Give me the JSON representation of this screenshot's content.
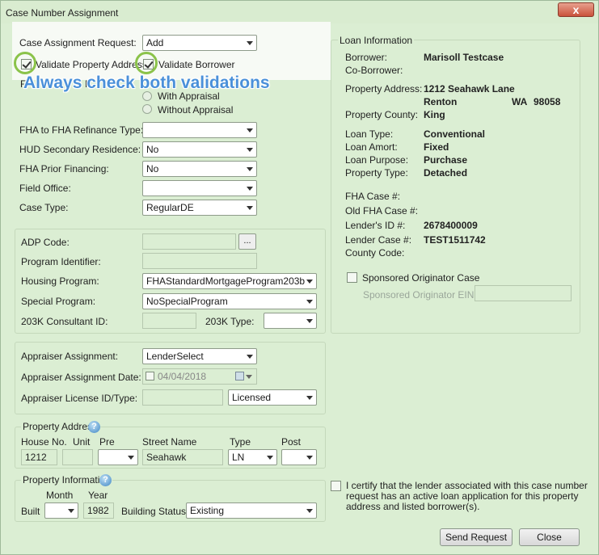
{
  "window": {
    "title": "Case Number Assignment",
    "close_glyph": "x"
  },
  "annotation": {
    "callout": "Always check both validations",
    "highlight_color": "#8bc34a",
    "callout_color": "#4a90d9"
  },
  "request": {
    "case_assignment_label": "Case Assignment Request:",
    "case_assignment_value": "Add",
    "validate_property_label": "Validate Property Address",
    "validate_property_checked": true,
    "validate_borrower_label": "Validate Borrower",
    "validate_borrower_checked": true,
    "hidden_label": "F",
    "hidden_label2": "F",
    "with_appraisal": "With Appraisal",
    "without_appraisal": "Without Appraisal",
    "fha_refi_type_label": "FHA to FHA Refinance Type:",
    "fha_refi_type_value": "",
    "hud_secondary_label": "HUD Secondary Residence:",
    "hud_secondary_value": "No",
    "fha_prior_label": "FHA Prior Financing:",
    "fha_prior_value": "No",
    "field_office_label": "Field Office:",
    "field_office_value": "",
    "case_type_label": "Case Type:",
    "case_type_value": "RegularDE"
  },
  "program": {
    "adp_code_label": "ADP Code:",
    "adp_code_value": "",
    "browse_label": "...",
    "program_id_label": "Program Identifier:",
    "program_id_value": "",
    "housing_program_label": "Housing Program:",
    "housing_program_value": "FHAStandardMortgageProgram203b",
    "special_program_label": "Special Program:",
    "special_program_value": "NoSpecialProgram",
    "consultant_label": "203K Consultant ID:",
    "consultant_value": "",
    "type_203k_label": "203K Type:",
    "type_203k_value": ""
  },
  "appraiser": {
    "assignment_label": "Appraiser Assignment:",
    "assignment_value": "LenderSelect",
    "date_label": "Appraiser Assignment Date:",
    "date_value": "04/04/2018",
    "license_label": "Appraiser License ID/Type:",
    "license_value": "",
    "license_type_value": "Licensed"
  },
  "property_address": {
    "legend": "Property Address",
    "house_no_label": "House No.",
    "unit_label": "Unit",
    "pre_label": "Pre",
    "street_label": "Street Name",
    "type_label": "Type",
    "post_label": "Post",
    "house_no": "1212",
    "unit": "",
    "pre": "",
    "street": "Seahawk",
    "type": "LN",
    "post": ""
  },
  "property_info": {
    "legend": "Property Information",
    "month_label": "Month",
    "year_label": "Year",
    "built_label": "Built",
    "month_value": "",
    "year_value": "1982",
    "building_status_label": "Building Status",
    "building_status_value": "Existing"
  },
  "loan_info": {
    "legend": "Loan Information",
    "borrower_label": "Borrower:",
    "borrower": "Marisoll Testcase",
    "coborrower_label": "Co-Borrower:",
    "coborrower": "",
    "property_address_label": "Property Address:",
    "address_line1": "1212 Seahawk Lane",
    "city": "Renton",
    "state": "WA",
    "zip": "98058",
    "county_label": "Property County:",
    "county": "King",
    "loan_type_label": "Loan Type:",
    "loan_type": "Conventional",
    "loan_amort_label": "Loan Amort:",
    "loan_amort": "Fixed",
    "loan_purpose_label": "Loan Purpose:",
    "loan_purpose": "Purchase",
    "property_type_label": "Property Type:",
    "property_type": "Detached",
    "fha_case_label": "FHA Case #:",
    "fha_case": "",
    "old_fha_case_label": "Old FHA Case #:",
    "old_fha_case": "",
    "lender_id_label": "Lender's ID #:",
    "lender_id": "2678400009",
    "lender_case_label": "Lender Case #:",
    "lender_case": "TEST1511742",
    "county_code_label": "County Code:",
    "county_code": "",
    "sponsored_label": "Sponsored Originator Case",
    "sponsored_ein_label": "Sponsored Originator EIN:",
    "sponsored_ein": ""
  },
  "certify": {
    "line1": "I certify that the lender associated with this case number",
    "line2": "request has an active loan application for this property",
    "line3": "address and listed borrower(s)."
  },
  "buttons": {
    "send": "Send Request",
    "close": "Close"
  }
}
